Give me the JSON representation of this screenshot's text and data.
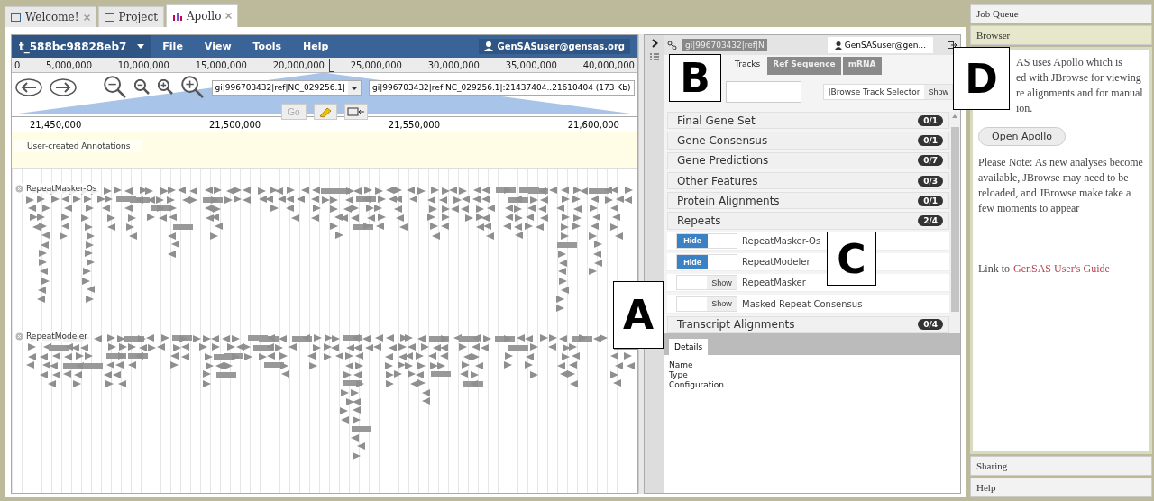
{
  "tabs": [
    {
      "label": "Welcome!",
      "selected": false,
      "closable": true
    },
    {
      "label": "Project",
      "selected": false,
      "closable": false
    },
    {
      "label": "Apollo",
      "selected": true,
      "closable": true
    }
  ],
  "menu_bar": {
    "dataset": "t_588bc98828eb7",
    "menus": [
      "File",
      "View",
      "Tools",
      "Help"
    ],
    "user": "GenSASuser@gensas.org"
  },
  "overview_ruler": {
    "ticks": [
      "0",
      "5,000,000",
      "10,000,000",
      "15,000,000",
      "20,000,000",
      "25,000,000",
      "30,000,000",
      "35,000,000",
      "40,000,000"
    ]
  },
  "navigation": {
    "sequence": "gi|996703432|ref|NC_029256.1|",
    "location": "gi|996703432|ref|NC_029256.1|:21437404..21610404 (173 Kb)",
    "go": "Go",
    "go_disabled": true
  },
  "detail_ruler": {
    "ticks": [
      "21,450,000",
      "21,500,000",
      "21,550,000",
      "21,600,000"
    ]
  },
  "annotation_track": {
    "label": "User-created Annotations"
  },
  "feature_tracks": [
    {
      "label": "RepeatMasker-Os"
    },
    {
      "label": "RepeatModeler"
    }
  ],
  "side_panel": {
    "sequence_tab": "gi|996703432|ref|N",
    "user": "GenSASuser@gen...",
    "tabs": [
      {
        "label": "Tracks",
        "selected": true
      },
      {
        "label": "Ref Sequence",
        "selected": false
      },
      {
        "label": "mRNA",
        "selected": false
      }
    ],
    "track_selector": {
      "label": "JBrowse Track Selector",
      "button": "Show"
    },
    "categories": [
      {
        "name": "Final Gene Set",
        "count": "0/1"
      },
      {
        "name": "Gene Consensus",
        "count": "0/1"
      },
      {
        "name": "Gene Predictions",
        "count": "0/7"
      },
      {
        "name": "Other Features",
        "count": "0/3"
      },
      {
        "name": "Protein Alignments",
        "count": "0/1"
      },
      {
        "name": "Repeats",
        "count": "2/4",
        "tracks": [
          {
            "name": "RepeatMasker-Os",
            "on": true,
            "button": "Hide"
          },
          {
            "name": "RepeatModeler",
            "on": true,
            "button": "Hide"
          },
          {
            "name": "RepeatMasker",
            "on": false,
            "button": "Show"
          },
          {
            "name": "Masked Repeat Consensus",
            "on": false,
            "button": "Show"
          }
        ]
      },
      {
        "name": "Transcript Alignments",
        "count": "0/4"
      }
    ],
    "details": {
      "tab": "Details",
      "fields": [
        "Name",
        "Type",
        "Configuration"
      ]
    }
  },
  "sidebar": {
    "sections": [
      {
        "title": "Job Queue",
        "expanded": false
      },
      {
        "title": "Browser",
        "expanded": true
      },
      {
        "title": "Sharing",
        "expanded": false
      },
      {
        "title": "Help",
        "expanded": false
      }
    ],
    "browser": {
      "intro_lines": [
        "AS uses Apollo which is",
        "ed with JBrowse for viewing",
        "re alignments and for manual",
        "ion."
      ],
      "button": "Open Apollo",
      "note": "Please Note: As new analyses become available, JBrowse may need to be reloaded, and JBrowse make take a few moments to appear",
      "link_prefix": "Link to",
      "link": "GenSAS User's Guide"
    }
  },
  "callouts": [
    {
      "label": "A",
      "kind": "a"
    },
    {
      "label": "B",
      "kind": "b"
    },
    {
      "label": "C",
      "kind": "c"
    },
    {
      "label": "D",
      "kind": "d"
    }
  ]
}
